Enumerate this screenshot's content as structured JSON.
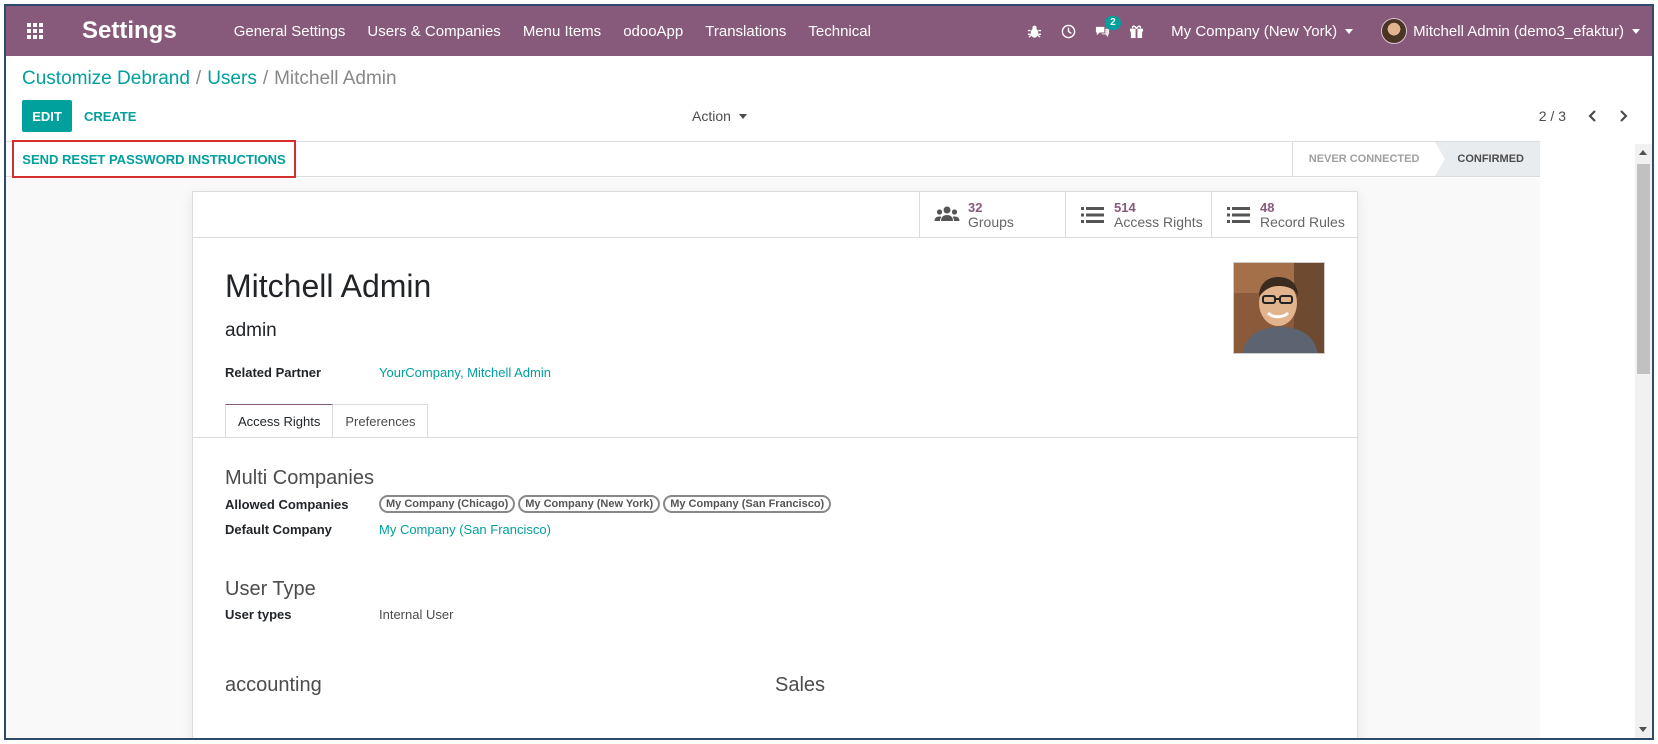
{
  "navbar": {
    "app_title": "Settings",
    "menu": [
      "General Settings",
      "Users & Companies",
      "Menu Items",
      "odooApp",
      "Translations",
      "Technical"
    ],
    "messages_badge": "2",
    "company": "My Company (New York)",
    "user": "Mitchell Admin (demo3_efaktur)",
    "color": "#875a7b"
  },
  "breadcrumb": {
    "items": [
      "Customize Debrand",
      "Users"
    ],
    "current": "Mitchell Admin"
  },
  "toolbar": {
    "edit_label": "EDIT",
    "create_label": "CREATE",
    "action_label": "Action",
    "pager": "2 / 3"
  },
  "statusbar": {
    "reset_button": "SEND RESET PASSWORD INSTRUCTIONS",
    "stages": [
      "NEVER CONNECTED",
      "CONFIRMED"
    ],
    "current_stage": "CONFIRMED"
  },
  "stat_buttons": [
    {
      "value": "32",
      "label": "Groups",
      "icon": "users-icon"
    },
    {
      "value": "514",
      "label": "Access Rights",
      "icon": "list-icon"
    },
    {
      "value": "48",
      "label": "Record Rules",
      "icon": "list-icon"
    }
  ],
  "form": {
    "name": "Mitchell Admin",
    "login": "admin",
    "related_partner_label": "Related Partner",
    "related_partner_value": "YourCompany, Mitchell Admin",
    "tabs": [
      "Access Rights",
      "Preferences"
    ],
    "active_tab": "Access Rights",
    "multi_companies_title": "Multi Companies",
    "allowed_companies_label": "Allowed Companies",
    "allowed_companies": [
      "My Company (Chicago)",
      "My Company (New York)",
      "My Company (San Francisco)"
    ],
    "default_company_label": "Default Company",
    "default_company_value": "My Company (San Francisco)",
    "user_type_title": "User Type",
    "user_types_label": "User types",
    "user_types_value": "Internal User",
    "accounting_title": "accounting",
    "sales_title": "Sales"
  },
  "accent_color": "#00a09d"
}
